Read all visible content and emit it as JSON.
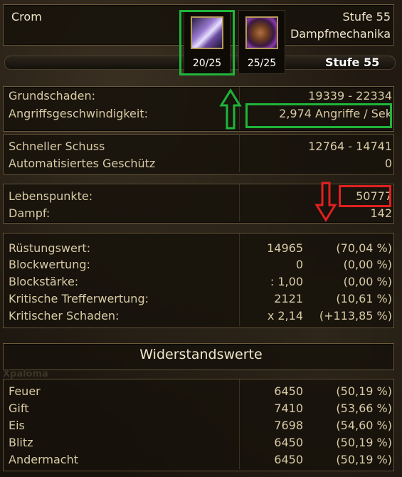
{
  "character": {
    "name": "Crom",
    "level": "Stufe 55",
    "class": "Dampfmechanika"
  },
  "slots": [
    {
      "icon": "crystal-shard-icon",
      "count": "20/25"
    },
    {
      "icon": "gauntlet-fist-icon",
      "count": "25/25"
    }
  ],
  "xp_bar": {
    "level_label": "Stufe 55"
  },
  "damage": {
    "base_label": "Grundschaden:",
    "base_value": "19339 - 22334",
    "speed_label": "Angriffsgeschwindigkeit:",
    "speed_value": "2,974 Angriffe / Sek"
  },
  "skills": {
    "skill1_label": "Schneller Schuss",
    "skill1_value": "12764 - 14741",
    "skill2_label": "Automatisiertes Geschütz",
    "skill2_value": "0"
  },
  "vitals": {
    "hp_label": "Lebenspunkte:",
    "hp_value": "50777",
    "steam_label": "Dampf:",
    "steam_value": "142"
  },
  "defense": [
    {
      "label": "Rüstungswert:",
      "value": "14965",
      "percent": "(70,04 %)"
    },
    {
      "label": "Blockwertung:",
      "value": "0",
      "percent": "(0,00 %)"
    },
    {
      "label": "Blockstärke:",
      "value": ": 1,00",
      "percent": "(0,00 %)"
    },
    {
      "label": "Kritische Trefferwertung:",
      "value": "2121",
      "percent": "(10,61 %)"
    },
    {
      "label": "Kritischer Schaden:",
      "value": "x 2,14",
      "percent": "(+113,85 %)"
    }
  ],
  "resistances": {
    "title": "Widerstandswerte",
    "watermark": "Xpaloma",
    "items": [
      {
        "label": "Feuer",
        "value": "6450",
        "percent": "(50,19 %)"
      },
      {
        "label": "Gift",
        "value": "7410",
        "percent": "(53,66 %)"
      },
      {
        "label": "Eis",
        "value": "7698",
        "percent": "(54,60 %)"
      },
      {
        "label": "Blitz",
        "value": "6450",
        "percent": "(50,19 %)"
      },
      {
        "label": "Andermacht",
        "value": "6450",
        "percent": "(50,19 %)"
      }
    ]
  },
  "annotations": {
    "green": "#1fb53a",
    "red": "#e02020"
  }
}
